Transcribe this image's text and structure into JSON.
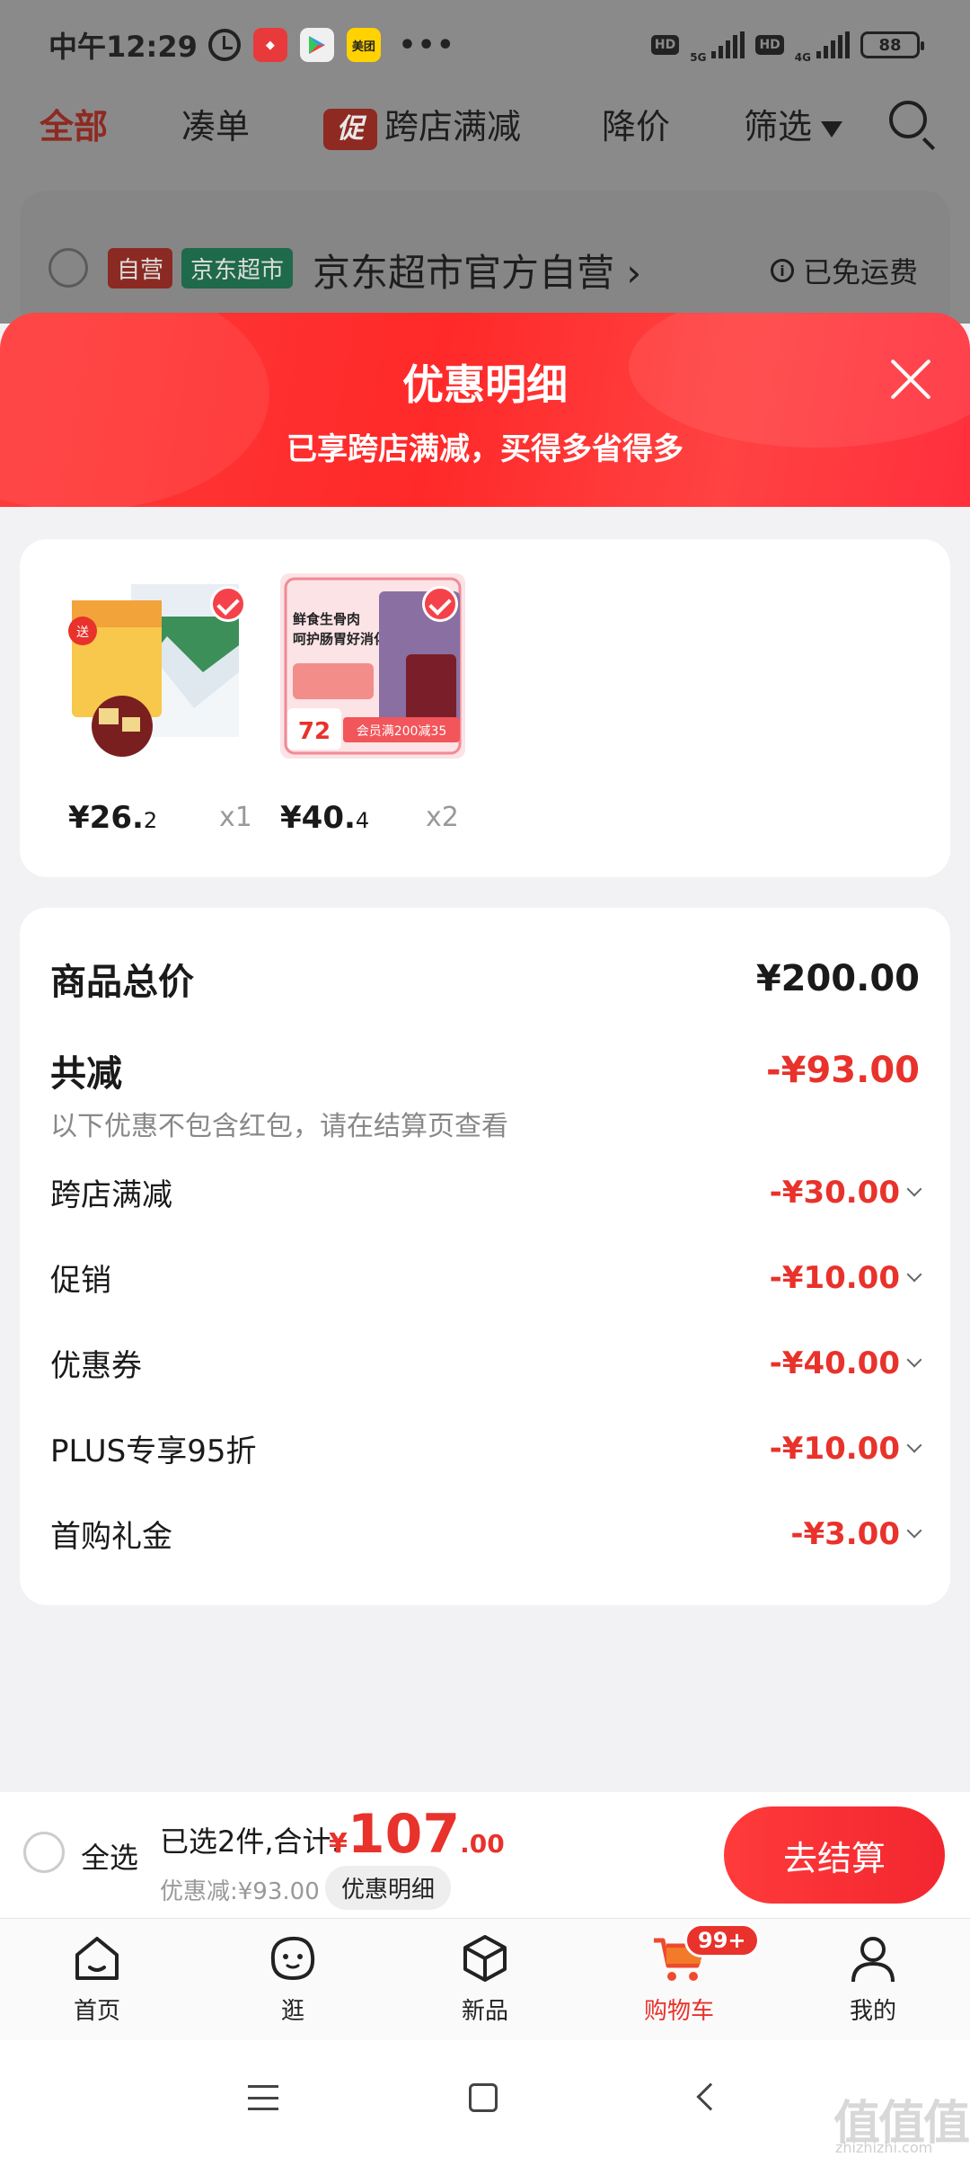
{
  "status_bar": {
    "time": "中午12:29",
    "meituan_label": "美团",
    "more_dots": "•••",
    "hd1": "HD",
    "net1": "5G",
    "hd2": "HD",
    "net2": "4G",
    "battery": "88"
  },
  "filter_tabs": {
    "all": "全部",
    "combine": "凑单",
    "promo_tag": "促",
    "cross_store": "跨店满减",
    "price_drop": "降价",
    "filter": "筛选"
  },
  "store": {
    "tag_self": "自营",
    "tag_market": "京东超市",
    "name": "京东超市官方自营 ›",
    "free_shipping": "已免运费"
  },
  "sheet": {
    "title": "优惠明细",
    "subtitle": "已享跨店满减，买得多省得多"
  },
  "products": [
    {
      "price_int": "¥26.",
      "price_dec": "2",
      "qty": "x1",
      "gift_tag": "送"
    },
    {
      "price_int": "¥40.",
      "price_dec": "4",
      "qty": "x2",
      "img_text1": "鲜食生骨肉",
      "img_text2": "呵护肠胃好消化",
      "img_number": "72",
      "img_promo": "会员满200减35"
    }
  ],
  "summary": {
    "total_label": "商品总价",
    "total_value": "¥200.00",
    "reduce_label": "共减",
    "reduce_value": "-¥93.00",
    "note": "以下优惠不包含红包，请在结算页查看",
    "items": [
      {
        "label": "跨店满减",
        "value": "-¥30.00"
      },
      {
        "label": "促销",
        "value": "-¥10.00"
      },
      {
        "label": "优惠券",
        "value": "-¥40.00"
      },
      {
        "label": "PLUS专享95折",
        "value": "-¥10.00"
      },
      {
        "label": "首购礼金",
        "value": "-¥3.00"
      }
    ]
  },
  "checkout": {
    "select_all": "全选",
    "selected_text": "已选2件,合计:",
    "total_currency": "¥",
    "total_int": "107",
    "total_dec": ".00",
    "discount_text": "优惠减:¥93.00",
    "detail_chip": "优惠明细",
    "checkout_button": "去结算"
  },
  "tabs": [
    {
      "label": "首页",
      "icon": "home-icon"
    },
    {
      "label": "逛",
      "icon": "browse-face-icon"
    },
    {
      "label": "新品",
      "icon": "box-icon"
    },
    {
      "label": "购物车",
      "icon": "cart-icon"
    },
    {
      "label": "我的",
      "icon": "person-icon"
    }
  ],
  "cart_badge": "99+",
  "watermark": {
    "main": "值值值",
    "sub": "zhizhizhi.com"
  },
  "colors": {
    "accent_red": "#e8322b",
    "sheet_red": "#ff2e36",
    "dim_overlay": "#8a8a8a"
  }
}
